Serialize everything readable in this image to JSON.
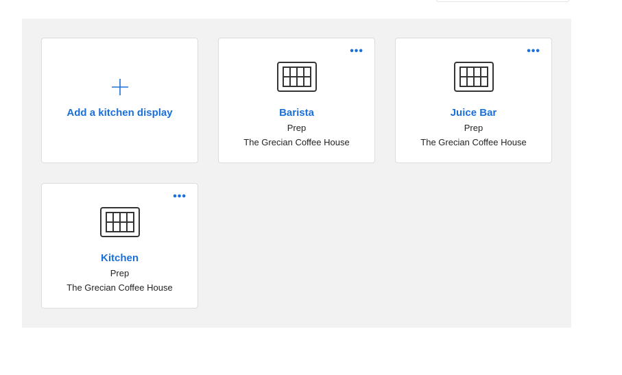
{
  "add_card": {
    "label": "Add a kitchen display"
  },
  "displays": [
    {
      "name": "Barista",
      "type": "Prep",
      "location": "The Grecian Coffee House"
    },
    {
      "name": "Juice Bar",
      "type": "Prep",
      "location": "The Grecian Coffee House"
    },
    {
      "name": "Kitchen",
      "type": "Prep",
      "location": "The Grecian Coffee House"
    }
  ],
  "more_label": "•••",
  "colors": {
    "accent": "#1b6fd8",
    "panel": "#f2f2f2"
  }
}
